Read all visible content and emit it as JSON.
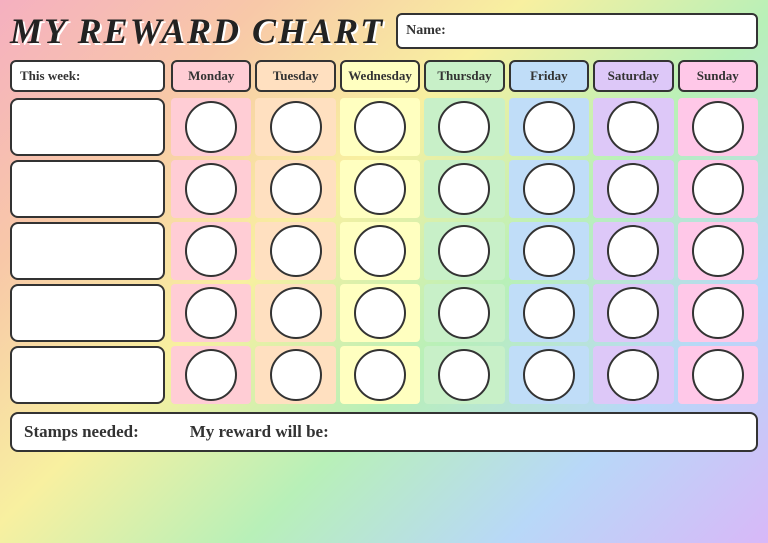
{
  "title": "MY REWARD CHART",
  "name_label": "Name:",
  "this_week_label": "This week:",
  "days": [
    "Monday",
    "Tuesday",
    "Wednesday",
    "Thursday",
    "Friday",
    "Saturday",
    "Sunday"
  ],
  "rows": 5,
  "bottom": {
    "stamps_label": "Stamps needed:",
    "reward_label": "My reward will be:"
  },
  "colors": {
    "background": "#f5b8c4",
    "stripes": [
      "#ffb3ba",
      "#ffd9b3",
      "#ffffb3",
      "#b3ffb3",
      "#b3e0ff",
      "#d9b3ff",
      "#ffb3e6"
    ],
    "cell_bg": "white",
    "border": "#222"
  }
}
